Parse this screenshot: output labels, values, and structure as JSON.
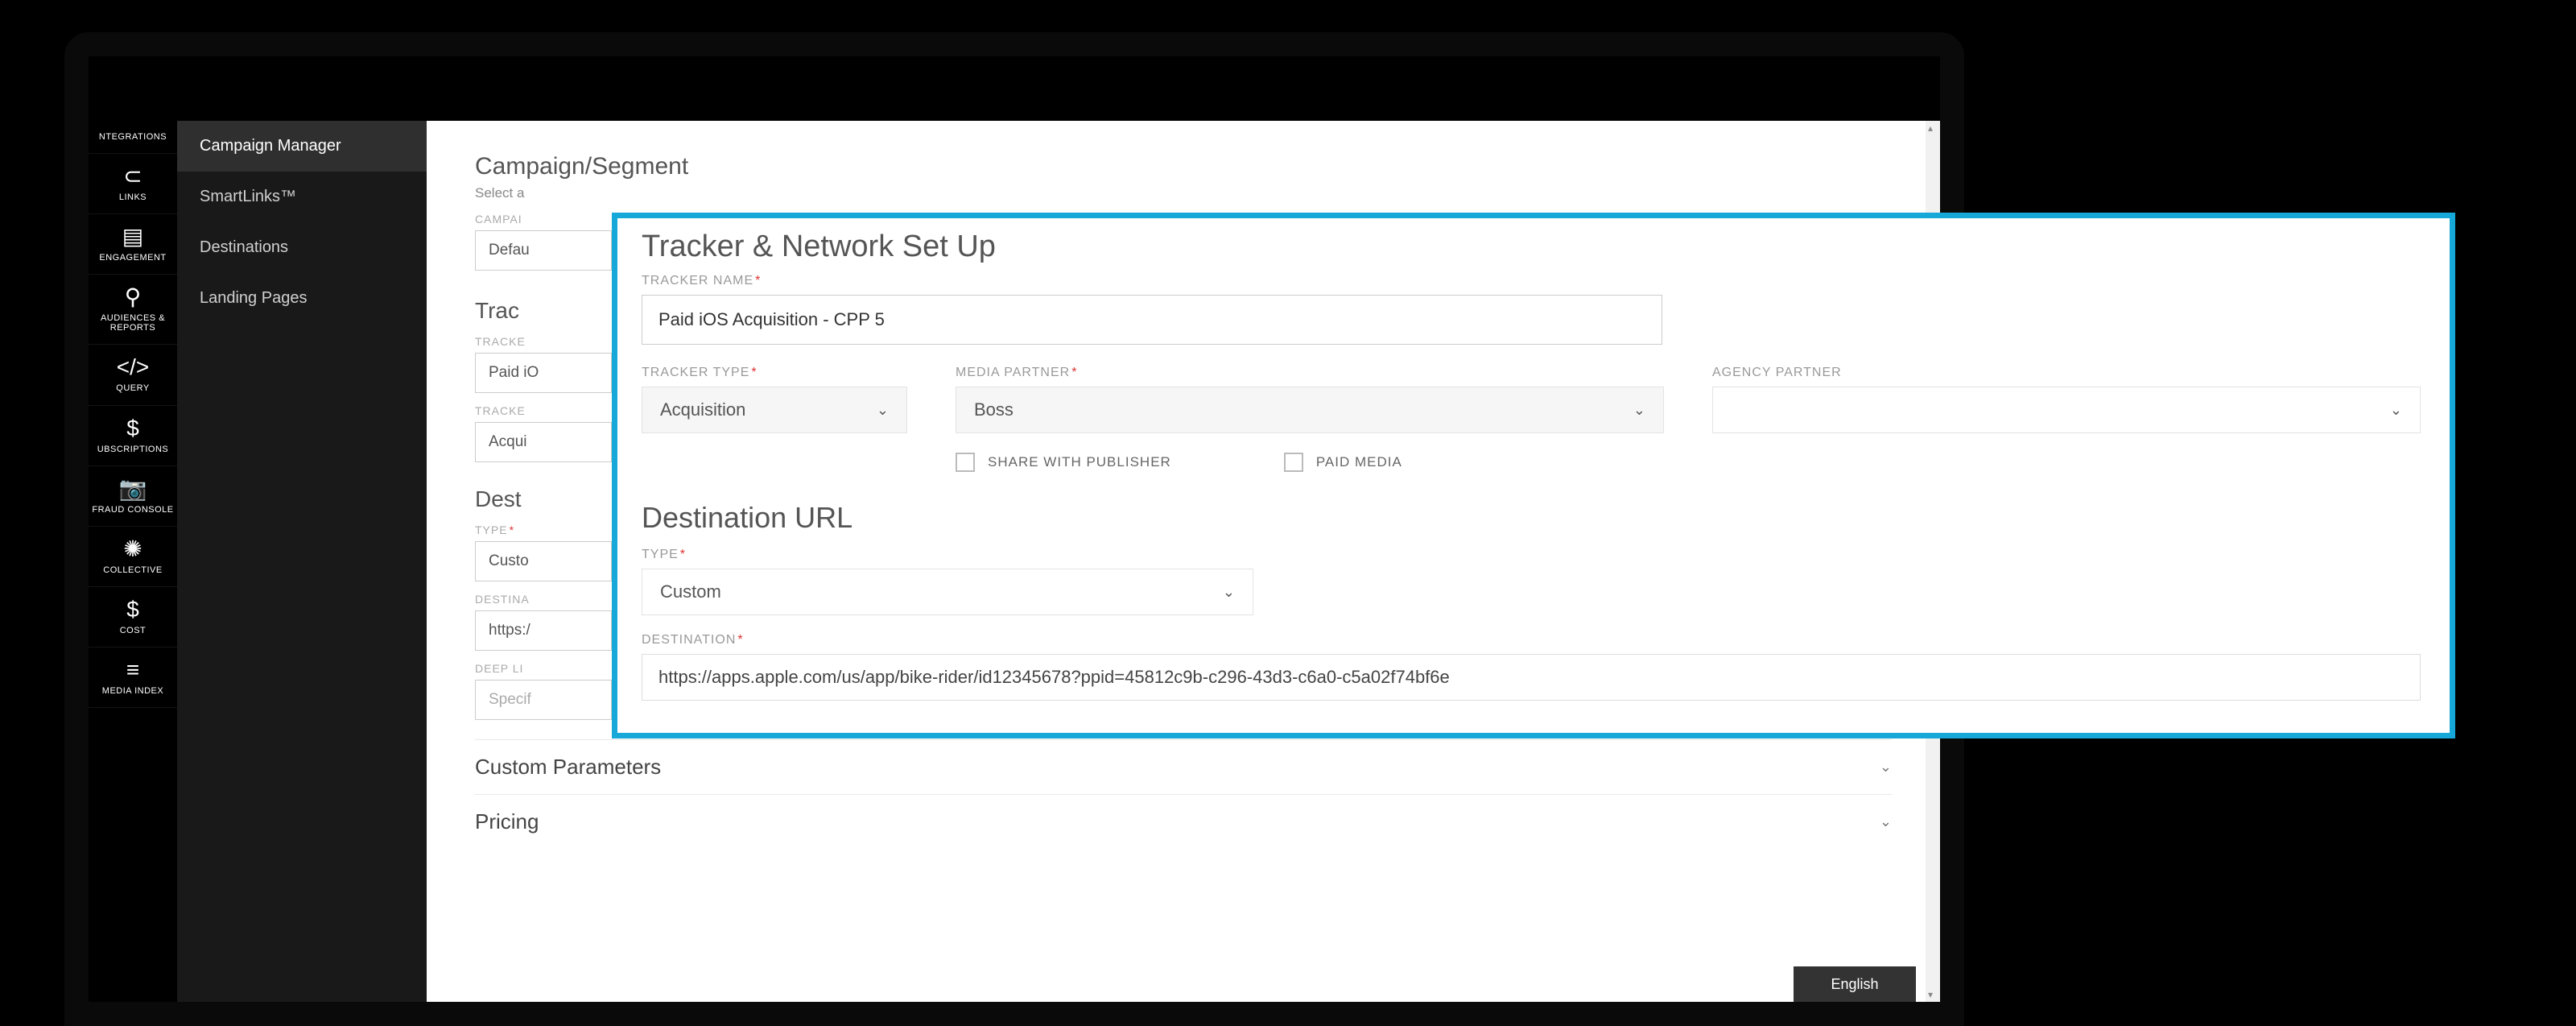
{
  "rail": {
    "items": [
      {
        "label": "NTEGRATIONS",
        "icon": "",
        "name": "integrations"
      },
      {
        "label": "LINKS",
        "icon": "⊂",
        "name": "links"
      },
      {
        "label": "ENGAGEMENT",
        "icon": "▤",
        "name": "engagement"
      },
      {
        "label": "AUDIENCES & REPORTS",
        "icon": "⚲",
        "name": "audiences-reports"
      },
      {
        "label": "QUERY",
        "icon": "</>",
        "name": "query"
      },
      {
        "label": "UBSCRIPTIONS",
        "icon": "$",
        "name": "subscriptions"
      },
      {
        "label": "FRAUD CONSOLE",
        "icon": "📷",
        "name": "fraud-console"
      },
      {
        "label": "COLLECTIVE",
        "icon": "✺",
        "name": "collective"
      },
      {
        "label": "COST",
        "icon": "$",
        "name": "cost"
      },
      {
        "label": "MEDIA INDEX",
        "icon": "≡",
        "name": "media-index"
      }
    ]
  },
  "subnav": {
    "items": [
      {
        "label": "Campaign Manager",
        "active": true
      },
      {
        "label": "SmartLinks™",
        "active": false
      },
      {
        "label": "Destinations",
        "active": false
      },
      {
        "label": "Landing Pages",
        "active": false
      }
    ]
  },
  "main": {
    "campaign_segment": {
      "title": "Campaign/Segment",
      "hint": "Select a",
      "campaign_label": "CAMPAI",
      "campaign_value": "Defau"
    },
    "tracker": {
      "title": "Trac",
      "name_label": "TRACKE",
      "name_value": "Paid iO",
      "type_label": "TRACKE",
      "type_value": "Acqui"
    },
    "destination": {
      "title": "Dest",
      "type_label": "TYPE",
      "type_value": "Custo",
      "dest_label": "DESTINA",
      "dest_value": "https:/",
      "deep_label": "DEEP LI",
      "deep_value": "Specif"
    },
    "custom_parameters": {
      "title": "Custom Parameters"
    },
    "pricing": {
      "title": "Pricing"
    }
  },
  "overlay": {
    "title": "Tracker & Network Set Up",
    "tracker_name": {
      "label": "TRACKER NAME",
      "value": "Paid iOS Acquisition - CPP 5"
    },
    "tracker_type": {
      "label": "TRACKER TYPE",
      "value": "Acquisition"
    },
    "media_partner": {
      "label": "MEDIA PARTNER",
      "value": "Boss"
    },
    "agency_partner": {
      "label": "AGENCY PARTNER",
      "value": ""
    },
    "share_publisher": {
      "label": "SHARE WITH PUBLISHER",
      "checked": false
    },
    "paid_media": {
      "label": "PAID MEDIA",
      "checked": false
    },
    "destination_url": {
      "title": "Destination URL",
      "type_label": "TYPE",
      "type_value": "Custom",
      "dest_label": "DESTINATION",
      "dest_value": "https://apps.apple.com/us/app/bike-rider/id12345678?ppid=45812c9b-c296-43d3-c6a0-c5a02f74bf6e"
    }
  },
  "language": "English"
}
